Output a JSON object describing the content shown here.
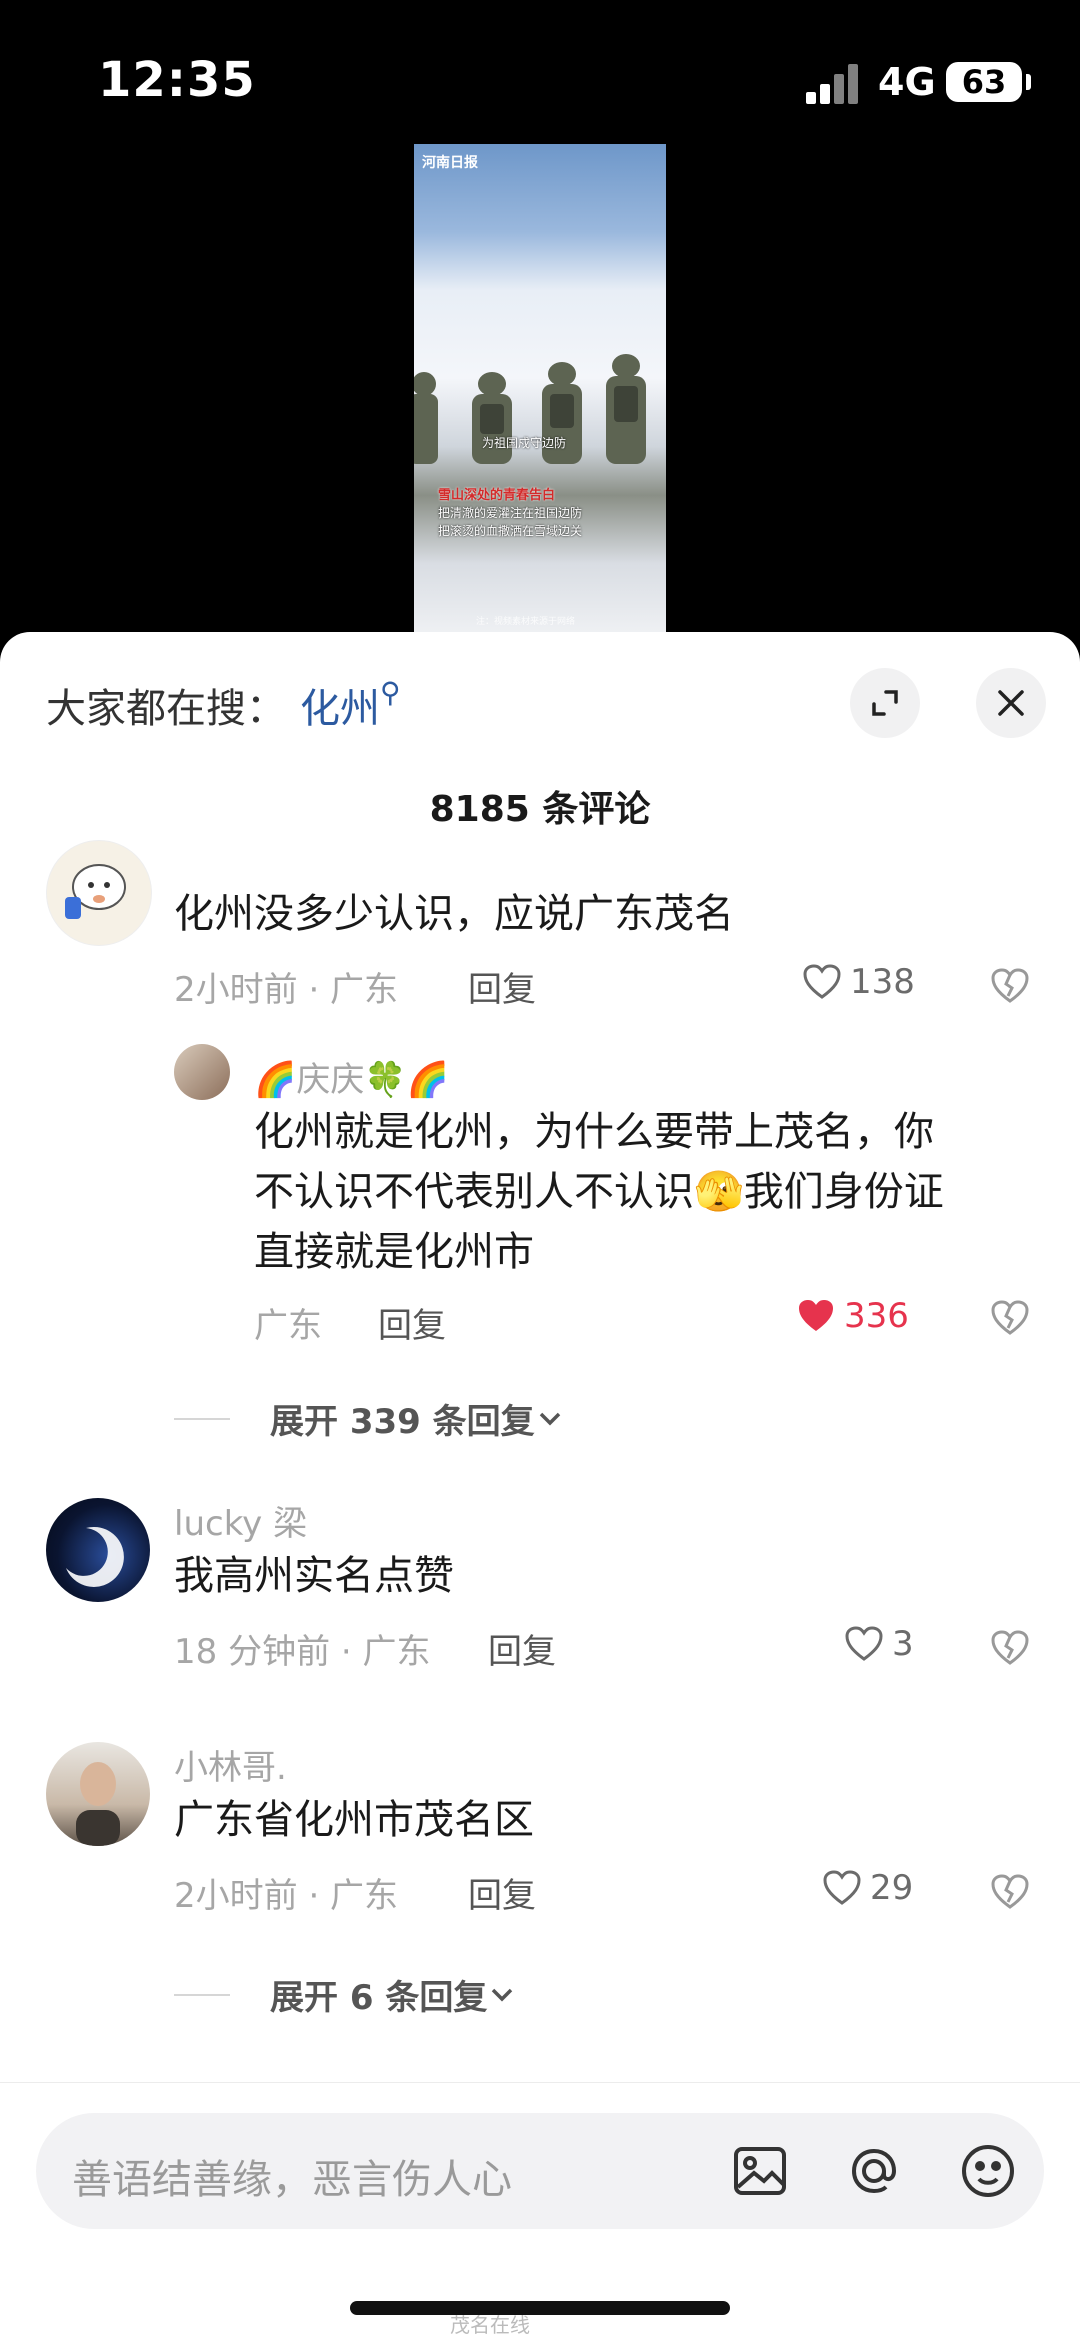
{
  "status_bar": {
    "time": "12:35",
    "network": "4G",
    "battery": "63"
  },
  "video": {
    "logo": "河南日报",
    "caption_top": "为祖国戍守边防",
    "caption_title": "雪山深处的青春告白",
    "caption_line1": "把清澈的爱灌注在祖国边防",
    "caption_line2": "把滚烫的血撒洒在雪域边关",
    "footer": "注：视频素材来源于网络"
  },
  "search": {
    "prefix": "大家都在搜：",
    "keyword": "化州"
  },
  "comments_header": {
    "count": "8185 条评论"
  },
  "comments": [
    {
      "text": "化州没多少认识，应说广东茂名",
      "meta": "2小时前 · 广东",
      "reply": "回复",
      "likes": "138"
    },
    {
      "user": "🌈庆庆🍀🌈",
      "text_line1": "化州就是化州，为什么要带上茂名，你",
      "text_line2": "不认识不代表别人不认识🫣我们身份证",
      "text_line3": "直接就是化州市",
      "meta": "广东",
      "reply": "回复",
      "likes": "336"
    },
    {
      "expand": "展开 339 条回复"
    },
    {
      "user": "lucky 梁",
      "text": "我高州实名点赞",
      "meta": "18 分钟前 · 广东",
      "reply": "回复",
      "likes": "3"
    },
    {
      "user": "小林哥.",
      "text": "广东省化州市茂名区",
      "meta": "2小时前 · 广东",
      "reply": "回复",
      "likes": "29"
    },
    {
      "expand": "展开 6 条回复"
    }
  ],
  "input": {
    "placeholder": "善语结善缘，恶言伤人心"
  },
  "watermark": "茂名在线",
  "colors": {
    "keyword": "#2c5aa0",
    "liked": "#e6334d",
    "meta": "#a6a6a6"
  }
}
